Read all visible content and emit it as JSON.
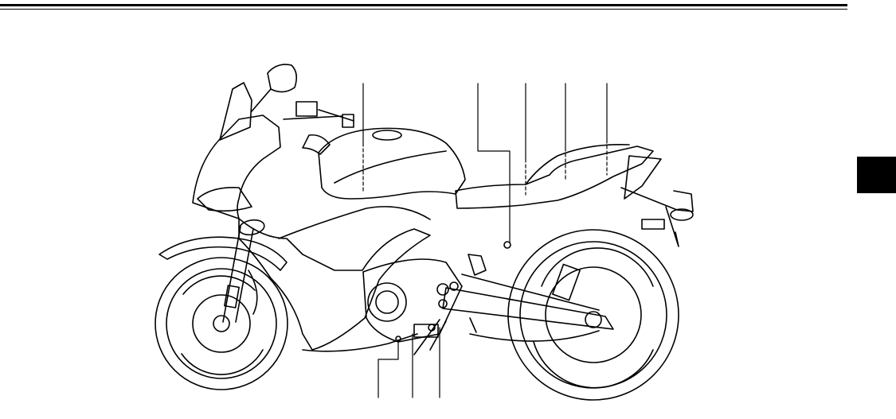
{
  "page": {
    "section_tab_label": ""
  },
  "illustration": {
    "subject": "motorcycle-side-view",
    "callout_count": 8
  }
}
